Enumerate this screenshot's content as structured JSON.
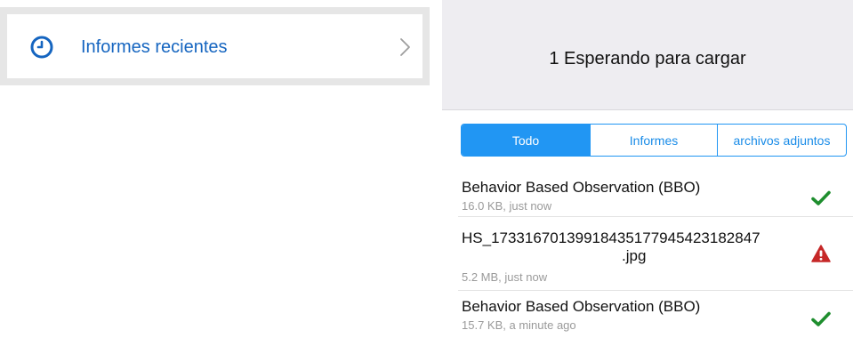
{
  "recent_reports": {
    "label": "Informes recientes",
    "icon": "clock-icon",
    "accent_color": "#1565c0"
  },
  "upload": {
    "title": "1 Esperando para cargar"
  },
  "tabs": [
    {
      "label": "Todo",
      "active": true
    },
    {
      "label": "Informes",
      "active": false
    },
    {
      "label": "archivos adjuntos",
      "active": false
    }
  ],
  "items": [
    {
      "name": "Behavior Based Observation (BBO)",
      "meta": "16.0 KB, just now",
      "status": "success",
      "status_icon": "check-icon",
      "status_color": "#1e8e2e"
    },
    {
      "name_line1": "HS_17331670139918435177945423182847",
      "name_line2": ".jpg",
      "meta": "5.2 MB, just now",
      "status": "error",
      "status_icon": "warning-icon",
      "status_color": "#c62828"
    },
    {
      "name": "Behavior Based Observation (BBO)",
      "meta": "15.7 KB, a minute ago",
      "status": "success",
      "status_icon": "check-icon",
      "status_color": "#1e8e2e"
    }
  ]
}
